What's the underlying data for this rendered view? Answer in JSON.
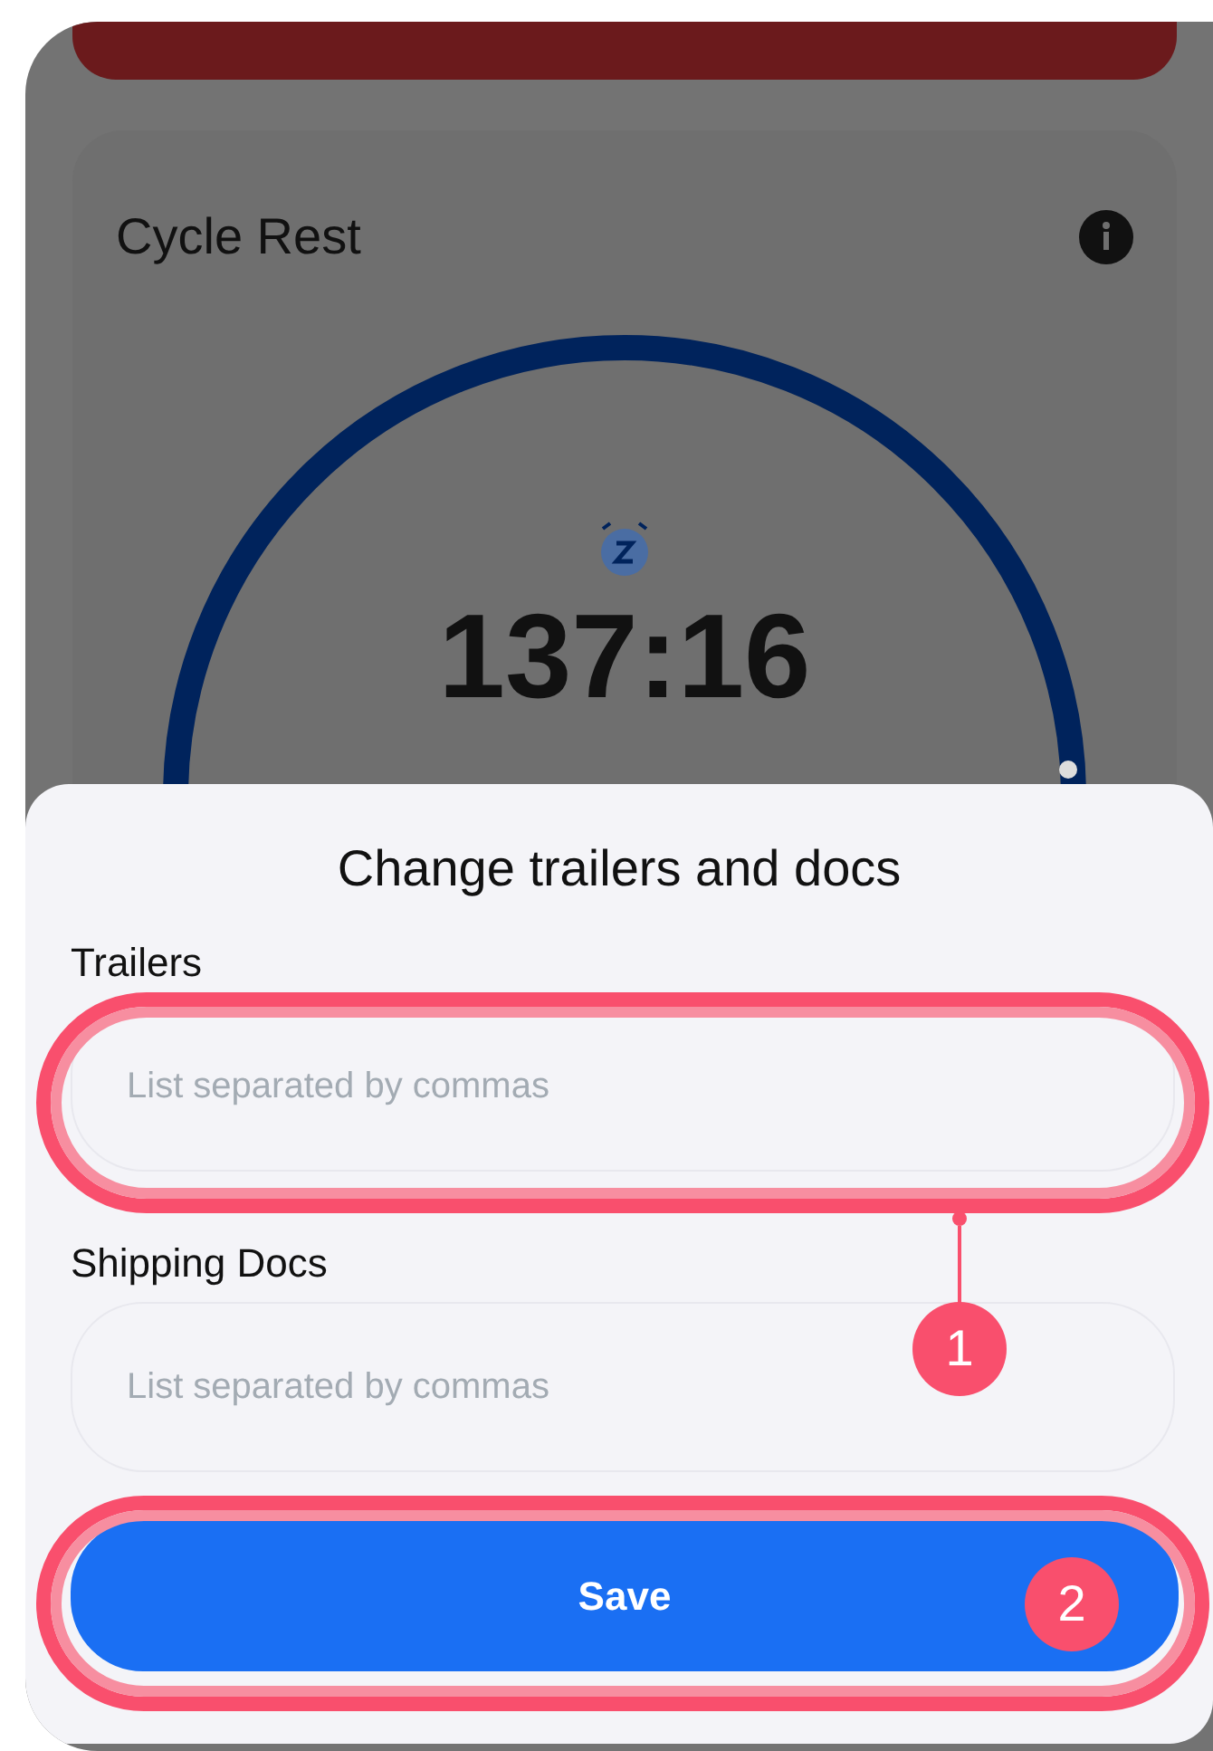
{
  "card": {
    "title": "Cycle Rest",
    "timer": "137:16"
  },
  "sheet": {
    "title": "Change trailers and docs",
    "fields": [
      {
        "label": "Trailers",
        "placeholder": "List separated by commas",
        "highlighted": true
      },
      {
        "label": "Shipping Docs",
        "placeholder": "List separated by commas",
        "highlighted": false
      }
    ],
    "save_button": {
      "label": "Save",
      "highlighted": true
    }
  },
  "callouts": [
    "1",
    "2"
  ]
}
